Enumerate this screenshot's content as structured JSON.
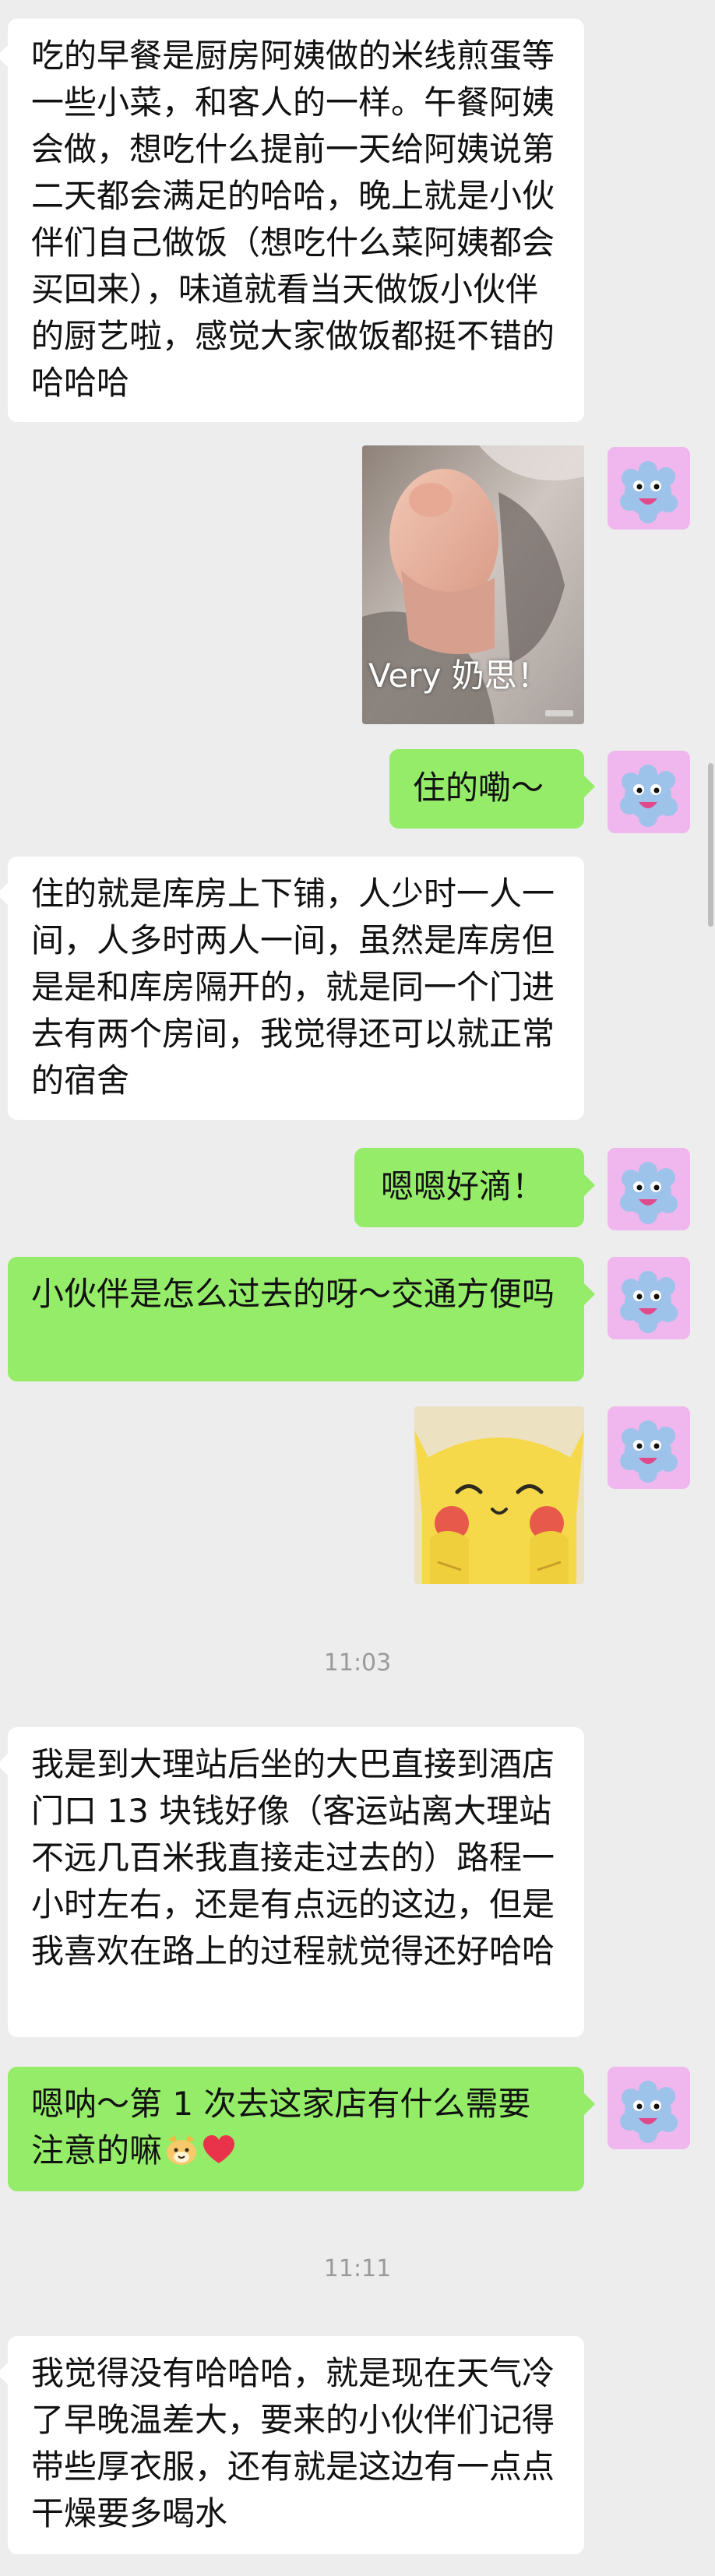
{
  "messages": {
    "m1": "吃的早餐是厨房阿姨做的米线煎蛋等一些小菜，和客人的一样。午餐阿姨会做，想吃什么提前一天给阿姨说第二天都会满足的哈哈，晚上就是小伙伴们自己做饭（想吃什么菜阿姨都会买回来），味道就看当天做饭小伙伴的厨艺啦，感觉大家做饭都挺不错的哈哈哈",
    "m2_caption": "Very 奶思！",
    "m3": "住的嘞～",
    "m4": "住的就是库房上下铺，人少时一人一间，人多时两人一间，虽然是库房但是是和库房隔开的，就是同一个门进去有两个房间，我觉得还可以就正常的宿舍",
    "m5": "嗯嗯好滴！",
    "m6": "小伙伴是怎么过去的呀～交通方便吗",
    "ts1": "11:03",
    "m8": "我是到大理站后坐的大巴直接到酒店门口 13 块钱好像（客运站离大理站不远几百米我直接走过去的）路程一小时左右，还是有点远的这边，但是我喜欢在路上的过程就觉得还好哈哈",
    "m9": "嗯呐～第 1 次去这家店有什么需要注意的嘛",
    "ts2": "11:11",
    "m10": "我觉得没有哈哈哈，就是现在天气冷了早晚温差大，要来的小伙伴们记得带些厚衣服，还有就是这边有一点点干燥要多喝水"
  },
  "colors": {
    "bg": "#ededed",
    "sent": "#95ec69",
    "received": "#ffffff",
    "avatar_bg": "#f0b6ee"
  },
  "icons": {
    "avatar": "blue-monster-avatar-icon",
    "emoji1": "cat-face-emoji-icon",
    "emoji2": "red-heart-emoji-icon"
  }
}
